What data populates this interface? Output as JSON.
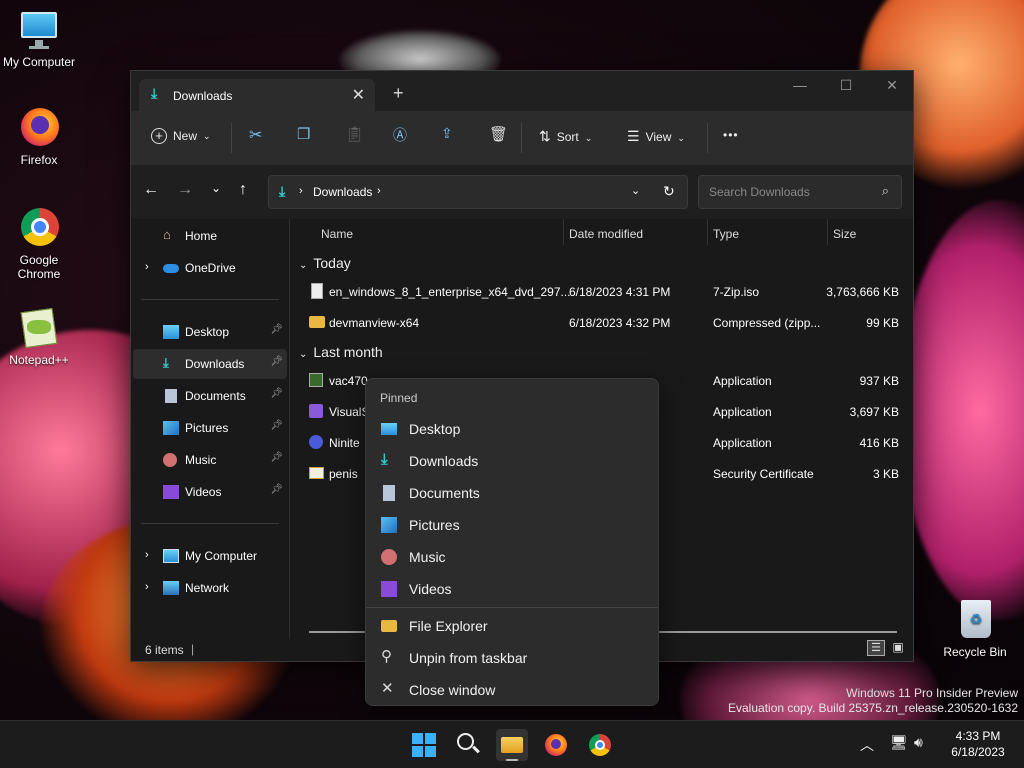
{
  "desktop": {
    "icons": [
      {
        "label": "My Computer"
      },
      {
        "label": "Firefox"
      },
      {
        "label": "Google Chrome"
      },
      {
        "label": "Notepad++"
      },
      {
        "label": "Recycle Bin"
      }
    ],
    "watermark_line1": "Windows 11 Pro Insider Preview",
    "watermark_line2": "Evaluation copy. Build 25375.zn_release.230520-1632"
  },
  "window": {
    "tab_title": "Downloads",
    "tab_close": "✕",
    "new_tab": "+",
    "minimize": "—",
    "maximize": "☐",
    "close": "✕"
  },
  "toolbar": {
    "new_label": "New",
    "sort_label": "Sort",
    "view_label": "View",
    "more_label": "•••"
  },
  "address": {
    "path": "Downloads",
    "search_placeholder": "Search Downloads"
  },
  "sidebar": {
    "items": [
      {
        "label": "Home",
        "icon": "home-icon"
      },
      {
        "label": "OneDrive",
        "icon": "cloud-icon"
      },
      {
        "label": "Desktop",
        "icon": "desktop-icon"
      },
      {
        "label": "Downloads",
        "icon": "download-icon"
      },
      {
        "label": "Documents",
        "icon": "document-icon"
      },
      {
        "label": "Pictures",
        "icon": "picture-icon"
      },
      {
        "label": "Music",
        "icon": "music-icon"
      },
      {
        "label": "Videos",
        "icon": "video-icon"
      },
      {
        "label": "My Computer",
        "icon": "computer-icon"
      },
      {
        "label": "Network",
        "icon": "network-icon"
      }
    ]
  },
  "columns": {
    "name": "Name",
    "date": "Date modified",
    "type": "Type",
    "size": "Size"
  },
  "groups": {
    "today": "Today",
    "last_month": "Last month"
  },
  "files": [
    {
      "name": "en_windows_8_1_enterprise_x64_dvd_297...",
      "date": "6/18/2023 4:31 PM",
      "type": "7-Zip.iso",
      "size": "3,763,666 KB"
    },
    {
      "name": "devmanview-x64",
      "date": "6/18/2023 4:32 PM",
      "type": "Compressed (zipp...",
      "size": "99 KB"
    },
    {
      "name": "vac470",
      "date": "",
      "type": "Application",
      "size": "937 KB"
    },
    {
      "name": "VisualS",
      "date": "",
      "type": "Application",
      "size": "3,697 KB"
    },
    {
      "name": "Ninite",
      "date": "",
      "type": "Application",
      "size": "416 KB"
    },
    {
      "name": "penis",
      "date": "",
      "type": "Security Certificate",
      "size": "3 KB"
    }
  ],
  "status": {
    "items": "6 items"
  },
  "context_menu": {
    "header": "Pinned",
    "pinned": [
      {
        "label": "Desktop"
      },
      {
        "label": "Downloads"
      },
      {
        "label": "Documents"
      },
      {
        "label": "Pictures"
      },
      {
        "label": "Music"
      },
      {
        "label": "Videos"
      }
    ],
    "actions": [
      {
        "label": "File Explorer"
      },
      {
        "label": "Unpin from taskbar"
      },
      {
        "label": "Close window"
      }
    ]
  },
  "taskbar": {
    "time": "4:33 PM",
    "date": "6/18/2023"
  }
}
